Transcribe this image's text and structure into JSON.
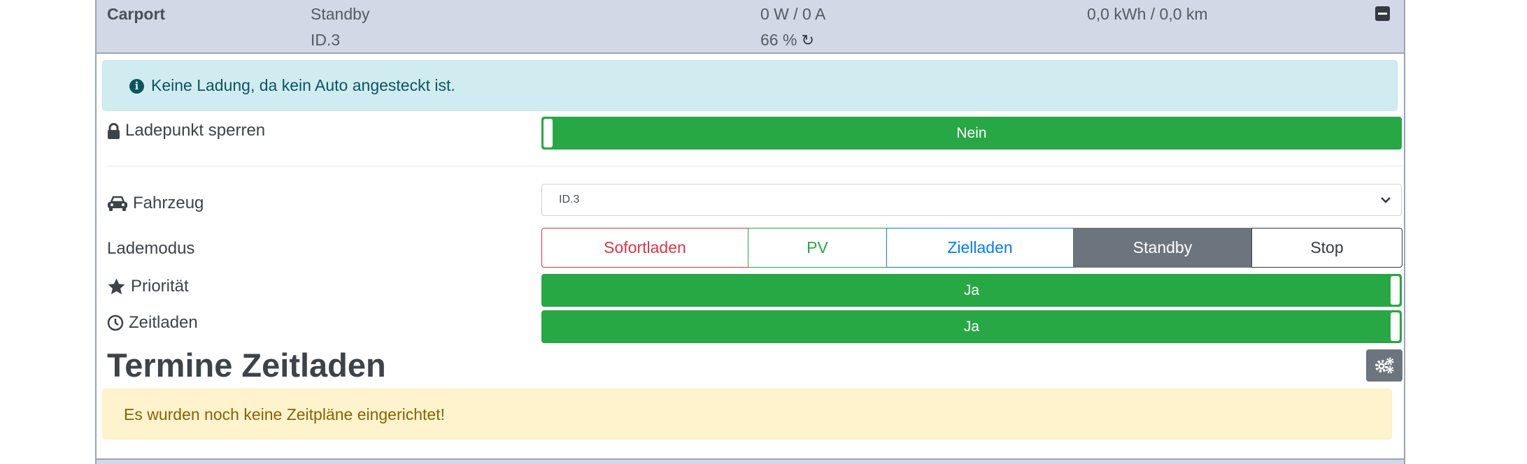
{
  "chargepoint": {
    "name": "Carport",
    "status": "Standby",
    "vehicle": "ID.3",
    "power": "0 W / 0 A",
    "soc": "66 %",
    "energy": "0,0 kWh / 0,0 km"
  },
  "info_alert": "Keine Ladung, da kein Auto angesteckt ist.",
  "lock": {
    "label": "Ladepunkt sperren",
    "value": "Nein"
  },
  "vehicle_select": {
    "label": "Fahrzeug",
    "value": "ID.3"
  },
  "charge_mode": {
    "label": "Lademodus",
    "options": [
      {
        "label": "Sofortladen",
        "color": "#dc3545"
      },
      {
        "label": "PV",
        "color": "#28a745"
      },
      {
        "label": "Zielladen",
        "color": "#007bff"
      },
      {
        "label": "Standby",
        "color": "#6c757d"
      },
      {
        "label": "Stop",
        "color": "#343a40"
      }
    ],
    "selected": "Standby"
  },
  "priority": {
    "label": "Priorität",
    "value": "Ja"
  },
  "timed_charging": {
    "label": "Zeitladen",
    "value": "Ja"
  },
  "schedule_section": {
    "title": "Termine Zeitladen",
    "empty_message": "Es wurden noch keine Zeitpläne eingerichtet!"
  },
  "colors": {
    "toggle_on": "#28a745",
    "header_bg": "#d3d8e6",
    "info_bg": "#d1ecf1",
    "warning_bg": "#fff3cd"
  }
}
